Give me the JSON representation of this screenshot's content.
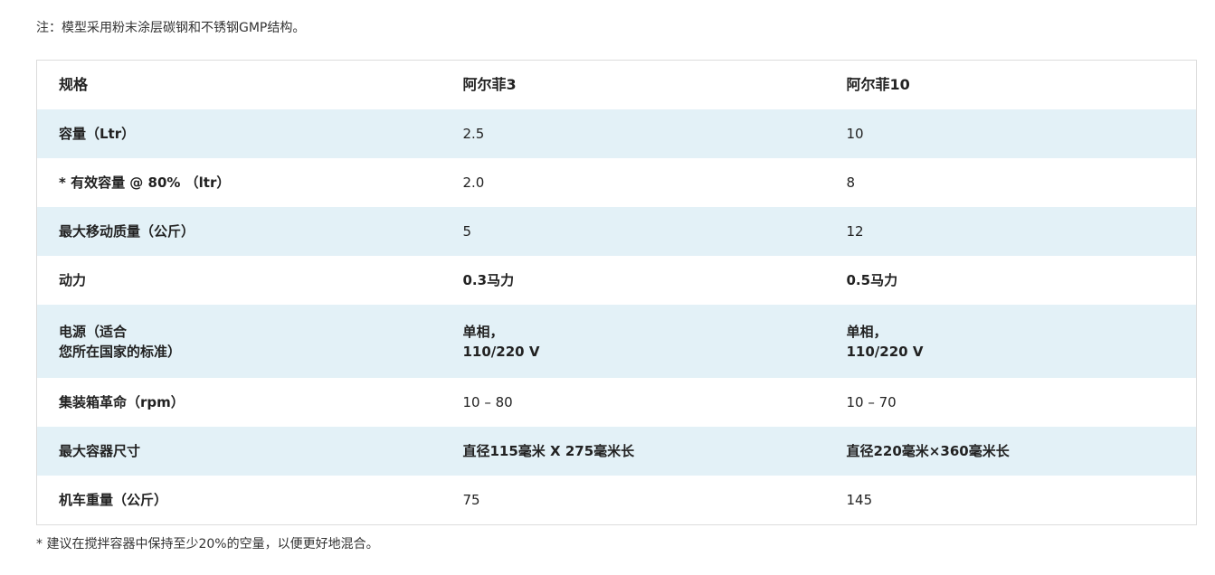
{
  "note_top": "注：模型采用粉末涂层碳钢和不锈钢GMP结构。",
  "table": {
    "headers": [
      "规格",
      "阿尔菲3",
      "阿尔菲10"
    ],
    "rows": [
      {
        "label": "容量（Ltr）",
        "alfie3": "2.5",
        "alfie10": "10"
      },
      {
        "label": "* 有效容量 @ 80% （ltr）",
        "alfie3": "2.0",
        "alfie10": "8"
      },
      {
        "label": "最大移动质量（公斤）",
        "alfie3": "5",
        "alfie10": "12"
      },
      {
        "label": "动力",
        "alfie3": "0.3马力",
        "alfie10": "0.5马力"
      },
      {
        "label": "电源（适合\n您所在国家的标准）",
        "alfie3": "单相，\n110/220 V",
        "alfie10": "单相，\n110/220 V"
      },
      {
        "label": "集装箱革命（rpm）",
        "alfie3": "10 – 80",
        "alfie10": "10 – 70"
      },
      {
        "label": "最大容器尺寸",
        "alfie3": "直径115毫米 X 275毫米长",
        "alfie10": "直径220毫米×360毫米长"
      },
      {
        "label": "机车重量（公斤）",
        "alfie3": "75",
        "alfie10": "145"
      }
    ]
  },
  "note_bottom": "* 建议在搅拌容器中保持至少20%的空量，以便更好地混合。",
  "colors": {
    "shaded_row": "#e3f1f7",
    "border": "#dcdcdc",
    "text": "#222222"
  }
}
